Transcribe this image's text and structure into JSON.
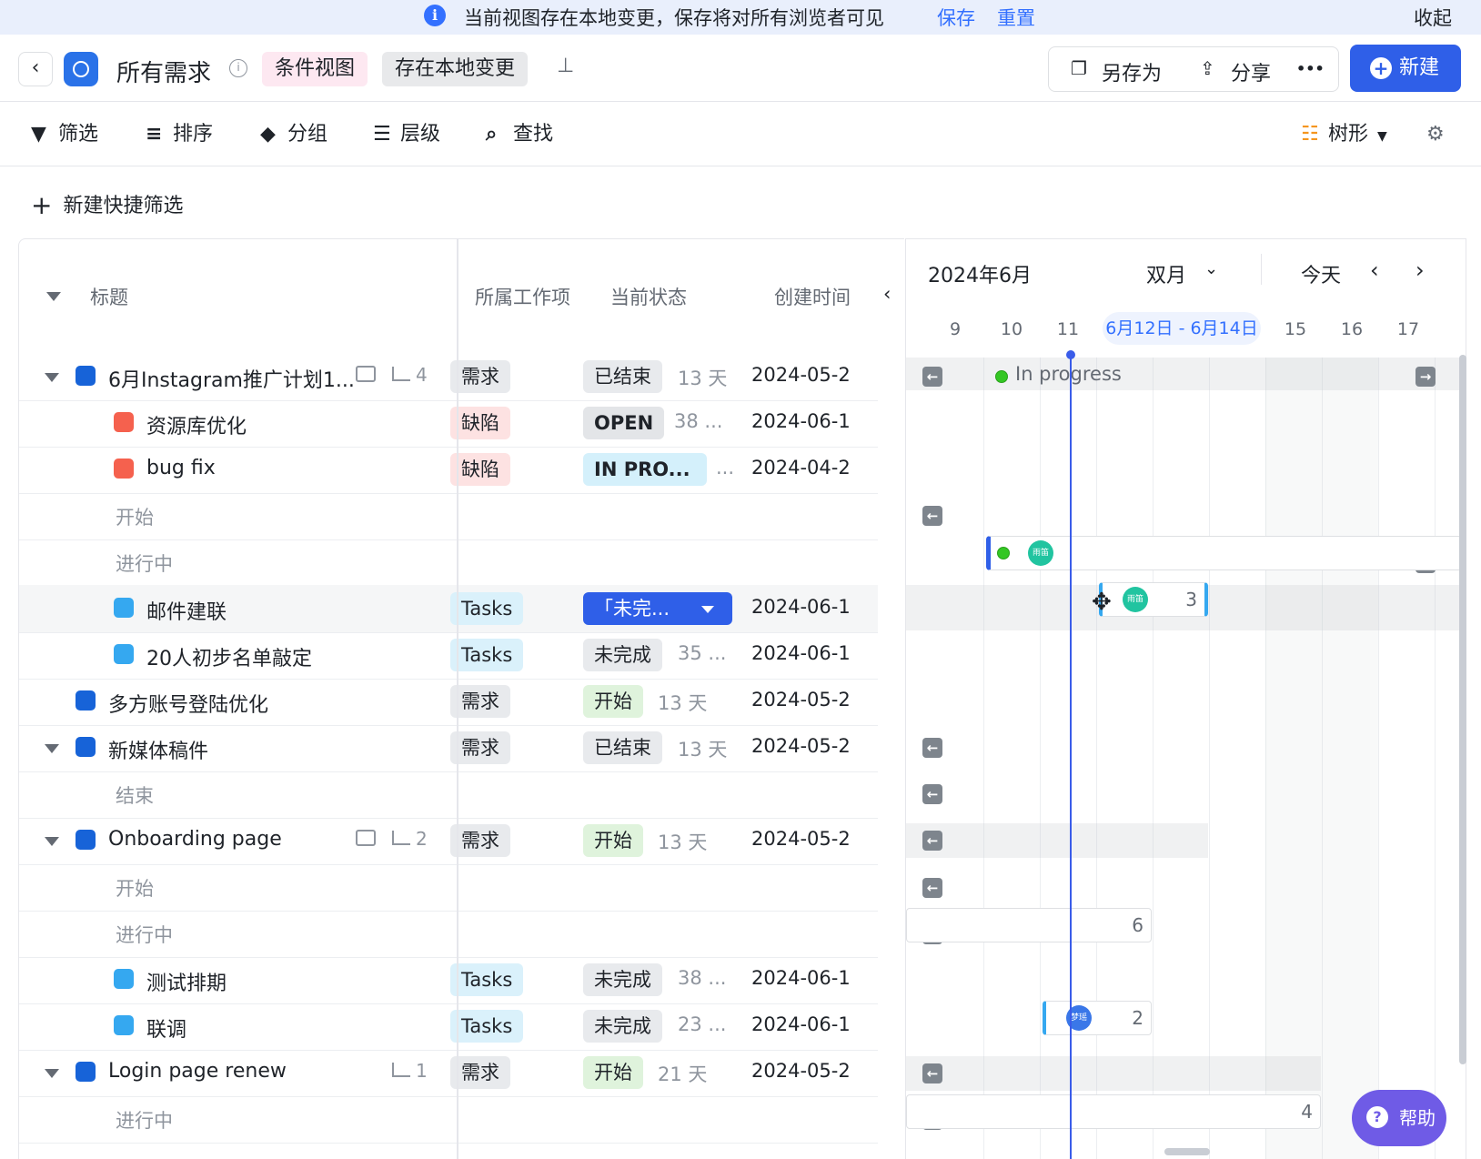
{
  "banner": {
    "message": "当前视图存在本地变更，保存将对所有浏览者可见",
    "save": "保存",
    "reset": "重置",
    "collapse": "收起"
  },
  "header": {
    "title": "所有需求",
    "tag_view": "条件视图",
    "tag_changes": "存在本地变更",
    "save_as": "另存为",
    "share": "分享",
    "more": "•••",
    "new": "新建"
  },
  "toolbar": {
    "filter": "筛选",
    "sort": "排序",
    "group": "分组",
    "level": "层级",
    "find": "查找",
    "tree": "树形"
  },
  "quick_filter": "新建快捷筛选",
  "columns": {
    "title": "标题",
    "work_item": "所属工作项",
    "status": "当前状态",
    "created": "创建时间"
  },
  "rows": [
    {
      "kind": "item",
      "level": 0,
      "expand": true,
      "name": "6月Instagram推广计划1...",
      "color": "#1763d8",
      "type": "需求",
      "status": "已结束",
      "duration": "13 天",
      "date": "2024-05-2",
      "subcount": "4",
      "comment": true
    },
    {
      "kind": "item",
      "level": 1,
      "name": "资源库优化",
      "color": "#f5614e",
      "type": "缺陷",
      "status": "OPEN",
      "duration": "38 ...",
      "date": "2024-06-1"
    },
    {
      "kind": "item",
      "level": 1,
      "name": "bug fix",
      "color": "#f5614e",
      "type": "缺陷",
      "status": "IN PRO...",
      "duration": "...",
      "date": "2024-04-2"
    },
    {
      "kind": "group",
      "name": "开始"
    },
    {
      "kind": "group",
      "name": "进行中"
    },
    {
      "kind": "item",
      "level": 1,
      "name": "邮件建联",
      "color": "#35a8f0",
      "type": "Tasks",
      "status": "「未完...",
      "duration": "",
      "date": "2024-06-1",
      "selected": true
    },
    {
      "kind": "item",
      "level": 1,
      "name": "20人初步名单敲定",
      "color": "#35a8f0",
      "type": "Tasks",
      "status": "未完成",
      "duration": "35 ...",
      "date": "2024-06-1"
    },
    {
      "kind": "item",
      "level": 0,
      "name": "多方账号登陆优化",
      "color": "#1763d8",
      "type": "需求",
      "status": "开始",
      "duration": "13 天",
      "date": "2024-05-2"
    },
    {
      "kind": "item",
      "level": 0,
      "expand": true,
      "name": "新媒体稿件",
      "color": "#1763d8",
      "type": "需求",
      "status": "已结束",
      "duration": "13 天",
      "date": "2024-05-2"
    },
    {
      "kind": "group",
      "name": "结束"
    },
    {
      "kind": "item",
      "level": 0,
      "expand": true,
      "name": "Onboarding page",
      "color": "#1763d8",
      "type": "需求",
      "status": "开始",
      "duration": "13 天",
      "date": "2024-05-2",
      "subcount": "2",
      "comment": true
    },
    {
      "kind": "group",
      "name": "开始"
    },
    {
      "kind": "group",
      "name": "进行中"
    },
    {
      "kind": "item",
      "level": 1,
      "name": "测试排期",
      "color": "#35a8f0",
      "type": "Tasks",
      "status": "未完成",
      "duration": "38 ...",
      "date": "2024-06-1"
    },
    {
      "kind": "item",
      "level": 1,
      "name": "联调",
      "color": "#35a8f0",
      "type": "Tasks",
      "status": "未完成",
      "duration": "23 ...",
      "date": "2024-06-1"
    },
    {
      "kind": "item",
      "level": 0,
      "expand": true,
      "name": "Login page renew",
      "color": "#1763d8",
      "type": "需求",
      "status": "开始",
      "duration": "21 天",
      "date": "2024-05-2",
      "subcount": "1"
    },
    {
      "kind": "group",
      "name": "进行中"
    }
  ],
  "gantt": {
    "month": "2024年6月",
    "range_mode": "双月",
    "today": "今天",
    "days": [
      "9",
      "10",
      "11",
      "6月12日 - 6月14日",
      "15",
      "16",
      "17"
    ],
    "in_progress_label": "In progress",
    "avatar_1": "雨笛",
    "avatar_2": "雨笛",
    "avatar_3": "梦瑶",
    "bar_counts": [
      "3",
      "6",
      "2",
      "4"
    ]
  },
  "help": "帮助"
}
